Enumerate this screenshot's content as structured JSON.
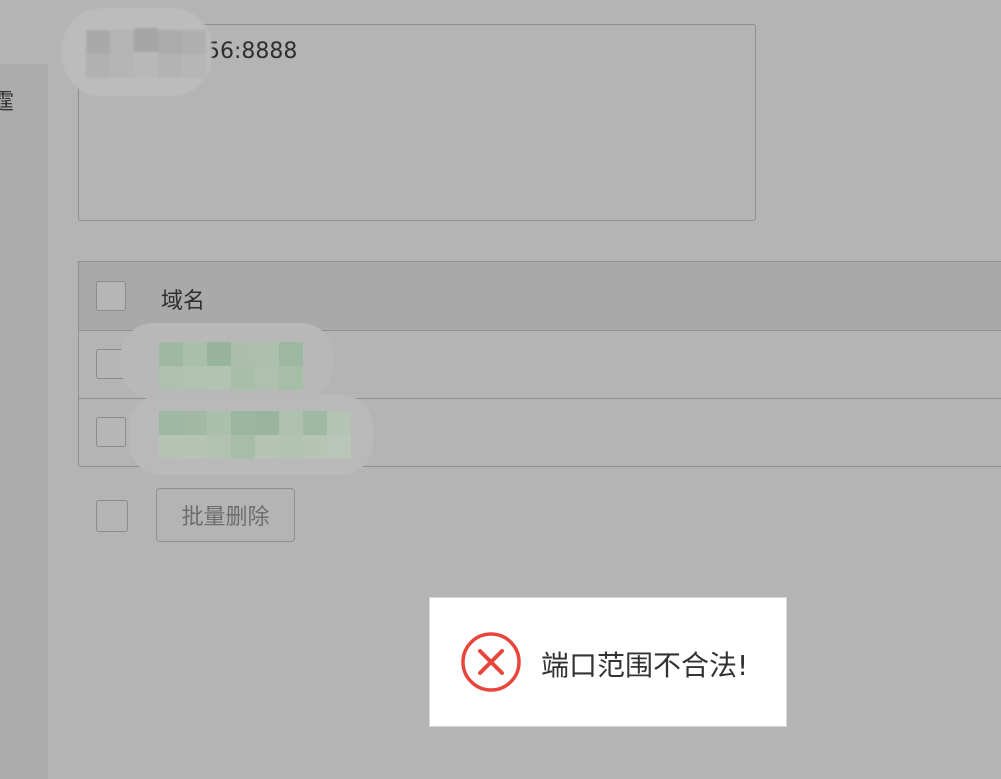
{
  "left_panel": {
    "glyph": "霆"
  },
  "textarea": {
    "value": ".56:8888"
  },
  "table": {
    "header": {
      "column_label": "域名"
    }
  },
  "bulk_actions": {
    "delete_label": "批量删除"
  },
  "toast": {
    "icon": "error-circle-icon",
    "message": "端口范围不合法!",
    "accent_color": "#e8453c"
  }
}
